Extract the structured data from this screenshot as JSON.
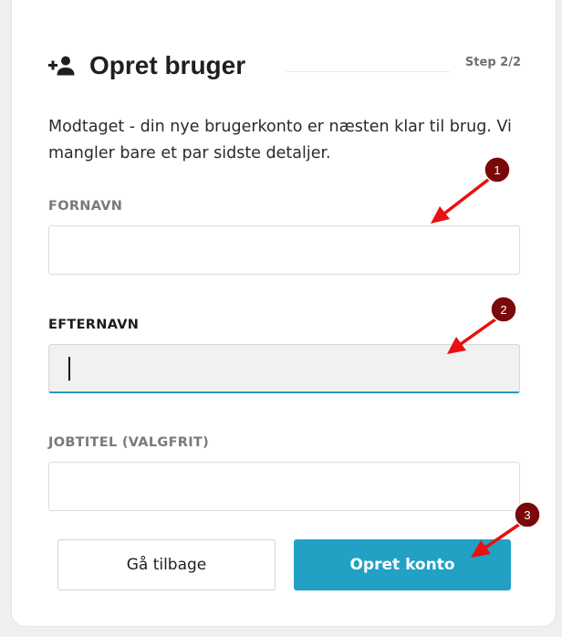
{
  "header": {
    "title": "Opret bruger",
    "step": "Step 2/2",
    "icon": "add-user-icon"
  },
  "intro": "Modtaget - din nye brugerkonto er næsten klar til brug. Vi mangler bare et par sidste detaljer.",
  "fields": {
    "first_name": {
      "label": "FORNAVN",
      "value": ""
    },
    "last_name": {
      "label": "EFTERNAVN",
      "value": ""
    },
    "job_title": {
      "label": "JOBTITEL (VALGFRIT)",
      "value": ""
    }
  },
  "buttons": {
    "back_label": "Gå tilbage",
    "create_label": "Opret konto"
  },
  "annotations": {
    "marker_1": "1",
    "marker_2": "2",
    "marker_3": "3"
  },
  "colors": {
    "accent": "#22a1c4",
    "focus_underline": "#2799bd",
    "annotation_marker": "#7a0a0a",
    "annotation_arrow": "#e81010"
  }
}
